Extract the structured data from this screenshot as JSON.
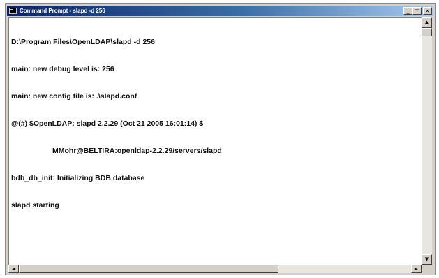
{
  "window": {
    "title": "Command Prompt - slapd -d 256",
    "buttons": {
      "minimize": "_",
      "maximize": "□",
      "close": "×"
    }
  },
  "console": {
    "lines": [
      "D:\\Program Files\\OpenLDAP\\slapd -d 256",
      "main: new debug level is: 256",
      "main: new config file is: .\\slapd.conf",
      "@(#) $OpenLDAP: slapd 2.2.29 (Oct 21 2005 16:01:14) $",
      "MMohr@BELTIRA:openldap-2.2.29/servers/slapd",
      "bdb_db_init: Initializing BDB database",
      "slapd starting"
    ]
  },
  "scrollbars": {
    "up_arrow": "▲",
    "down_arrow": "▼",
    "left_arrow": "◄",
    "right_arrow": "►"
  }
}
